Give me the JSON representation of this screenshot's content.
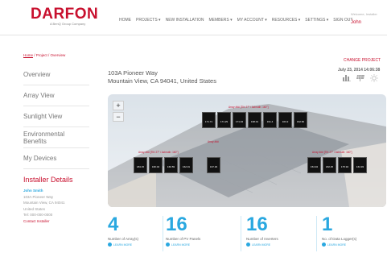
{
  "header": {
    "logo_text": "DARFON",
    "logo_tagline": "A BenQ Group Company",
    "nav": [
      "HOME",
      "PROJECTS ▾",
      "NEW INSTALLATION",
      "MEMBERS ▾",
      "MY ACCOUNT ▾",
      "RESOURCES ▾",
      "SETTINGS ▾",
      "SIGN OUT"
    ],
    "welcome": "Welcome, Installer",
    "user": "John"
  },
  "breadcrumb": {
    "home": "Home",
    "rest": " / Project / Overview"
  },
  "sidebar": {
    "items": [
      {
        "label": "Overview"
      },
      {
        "label": "Array View"
      },
      {
        "label": "Sunlight View"
      },
      {
        "label": "Environmental Benefits"
      },
      {
        "label": "My Devices"
      }
    ]
  },
  "installer": {
    "title": "Installer Details",
    "name": "John Smith",
    "street": "103A Pioneer Way",
    "city": "Mountain View, CA 94041",
    "country": "United States",
    "tel": "Tel: 000-000-0000",
    "contact": "Contact Installer"
  },
  "project": {
    "address_line1": "103A Pioneer Way",
    "address_line2": "Mountain View, CA 94041, United States",
    "change_project": "CHANGE PROJECT",
    "date": "July 23, 2014 14:06:38"
  },
  "map_controls": {
    "zoom_in": "+",
    "zoom_out": "−"
  },
  "arrays": [
    {
      "label": "Array ### [Tilt: 27° / Azimuth: 160°]",
      "values": [
        "171.71",
        "171.29",
        "171.04",
        "168.01",
        "191.4",
        "163.2",
        "162.60"
      ]
    },
    {
      "label": "Array ### [Tilt: 27° / Azimuth: 160°]",
      "values": [
        "184.15",
        "182.04",
        "160.59",
        "162.01"
      ]
    },
    {
      "label": "Array ###",
      "values": [
        "167.29"
      ]
    },
    {
      "label": "Array ### [Tilt: 27° / Azimuth: 160°]",
      "values": [
        "154.94",
        "182.25",
        "175.94",
        "164.93"
      ]
    }
  ],
  "stats": [
    {
      "value": "4",
      "label": "Number of Array(s)",
      "link": "LEARN MORE"
    },
    {
      "value": "16",
      "label": "Number of PV Panels",
      "link": "LEARN MORE"
    },
    {
      "value": "16",
      "label": "Number of Inverters",
      "link": "LEARN MORE"
    },
    {
      "value": "1",
      "label": "No. of Data Logger(s)",
      "link": "LEARN MORE"
    }
  ],
  "colors": {
    "brand": "#c8102e",
    "accent": "#2aa8e0"
  }
}
